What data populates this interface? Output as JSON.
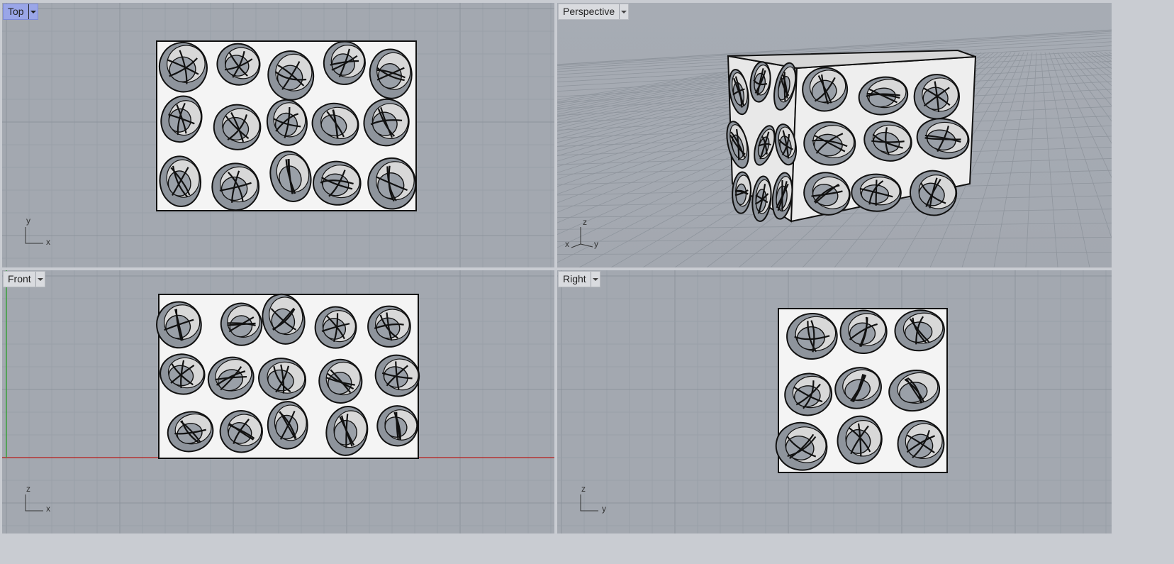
{
  "viewports": {
    "top": {
      "title": "Top",
      "axes": [
        "y",
        "x"
      ]
    },
    "perspective": {
      "title": "Perspective",
      "axes": [
        "z",
        "x",
        "y"
      ]
    },
    "front": {
      "title": "Front",
      "axes": [
        "z",
        "x"
      ]
    },
    "right": {
      "title": "Right",
      "axes": [
        "z",
        "y"
      ]
    }
  },
  "icons": {
    "dropdown": "chevron-down-icon"
  },
  "colors": {
    "viewport_bg": "#a3a8b0",
    "grid": "#939aa3",
    "active_tab": "#9aa6e8",
    "x_axis": "#b43232",
    "y_axis": "#3aa03a"
  }
}
